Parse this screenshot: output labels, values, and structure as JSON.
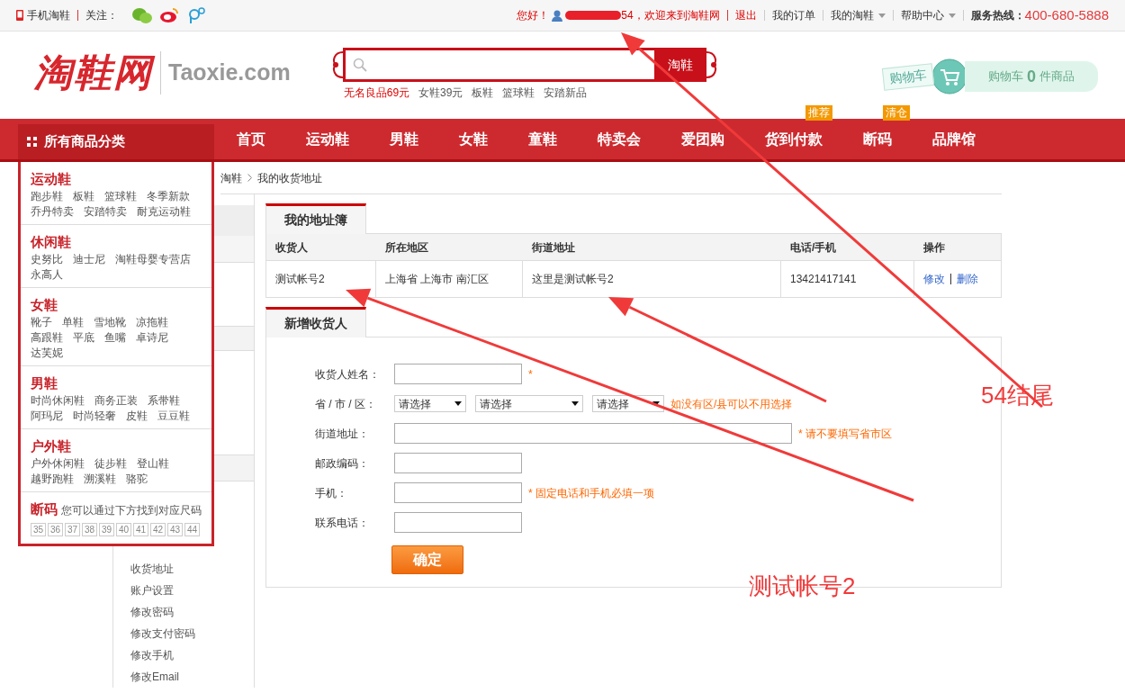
{
  "top_bar": {
    "mobile_label": "手机淘鞋",
    "follow_label": "关注：",
    "greeting": "您好！",
    "welcome": "54，欢迎来到淘鞋网",
    "logout": "退出",
    "links": [
      {
        "label": "我的订单",
        "dropdown": false
      },
      {
        "label": "我的淘鞋",
        "dropdown": true
      },
      {
        "label": "帮助中心",
        "dropdown": true
      }
    ],
    "hotline_label": "服务热线：",
    "hotline": "400-680-5888"
  },
  "header": {
    "logo": "淘鞋网",
    "domain": "Taoxie.com",
    "search_button": "淘鞋",
    "hot_words": [
      {
        "label": "无名良品69元",
        "highlight": true
      },
      {
        "label": "女鞋39元",
        "highlight": false
      },
      {
        "label": "板鞋",
        "highlight": false
      },
      {
        "label": "篮球鞋",
        "highlight": false
      },
      {
        "label": "安踏新品",
        "highlight": false
      }
    ],
    "cart": {
      "tag": "购物车",
      "label": "购物车",
      "count": "0",
      "unit": "件商品"
    }
  },
  "nav": {
    "category_label": "所有商品分类",
    "items": [
      {
        "label": "首页"
      },
      {
        "label": "运动鞋"
      },
      {
        "label": "男鞋"
      },
      {
        "label": "女鞋"
      },
      {
        "label": "童鞋"
      },
      {
        "label": "特卖会"
      },
      {
        "label": "爱团购"
      },
      {
        "label": "货到付款",
        "badge": "推荐"
      },
      {
        "label": "断码",
        "badge": "清仓"
      },
      {
        "label": "品牌馆"
      }
    ]
  },
  "category_menu": {
    "groups": [
      {
        "title": "运动鞋",
        "links": [
          "跑步鞋",
          "板鞋",
          "篮球鞋",
          "冬季新款",
          "乔丹特卖",
          "安踏特卖",
          "耐克运动鞋"
        ]
      },
      {
        "title": "休闲鞋",
        "links": [
          "史努比",
          "迪士尼",
          "淘鞋母婴专营店",
          "永高人"
        ]
      },
      {
        "title": "女鞋",
        "links": [
          "靴子",
          "单鞋",
          "雪地靴",
          "凉拖鞋",
          "高跟鞋",
          "平底",
          "鱼嘴",
          "卓诗尼",
          "达芙妮"
        ]
      },
      {
        "title": "男鞋",
        "links": [
          "时尚休闲鞋",
          "商务正装",
          "系带鞋",
          "阿玛尼",
          "时尚轻奢",
          "皮鞋",
          "豆豆鞋"
        ]
      },
      {
        "title": "户外鞋",
        "links": [
          "户外休闲鞋",
          "徒步鞋",
          "登山鞋",
          "越野跑鞋",
          "溯溪鞋",
          "骆驼"
        ]
      }
    ],
    "size_title": "断码",
    "size_note": "您可以通过下方找到对应尺码",
    "sizes": [
      "35",
      "36",
      "37",
      "38",
      "39",
      "40",
      "41",
      "42",
      "43",
      "44"
    ]
  },
  "breadcrumb": [
    "淘鞋",
    "我的收货地址"
  ],
  "sidebar": {
    "items": [
      "收货地址",
      "账户设置",
      "修改密码",
      "修改支付密码",
      "修改手机",
      "修改Email"
    ]
  },
  "address_book": {
    "tab": "我的地址簿",
    "columns": [
      "收货人",
      "所在地区",
      "街道地址",
      "电话/手机",
      "操作"
    ],
    "rows": [
      {
        "cells": [
          "测试帐号2",
          "上海省 上海市 南汇区",
          "这里是测试帐号2",
          "13421417141"
        ],
        "actions": [
          "修改",
          "删除"
        ]
      }
    ]
  },
  "form": {
    "tab": "新增收货人",
    "fields": [
      {
        "kind": "text",
        "label": "收货人姓名：",
        "hint": "*",
        "wide": false
      },
      {
        "kind": "selects",
        "label": "省 / 市 / 区：",
        "options": [
          "请选择",
          "请选择",
          "请选择"
        ],
        "hint": "如没有区/县可以不用选择"
      },
      {
        "kind": "text",
        "label": "街道地址：",
        "hint": "* 请不要填写省市区",
        "wide": true
      },
      {
        "kind": "text",
        "label": "邮政编码：",
        "wide": false
      },
      {
        "kind": "text",
        "label": "手机：",
        "hint": "* 固定电话和手机必填一项",
        "wide": false
      },
      {
        "kind": "text",
        "label": "联系电话：",
        "wide": false
      }
    ],
    "submit": "确定"
  },
  "annotations": [
    "54结尾",
    "测试帐号2"
  ]
}
